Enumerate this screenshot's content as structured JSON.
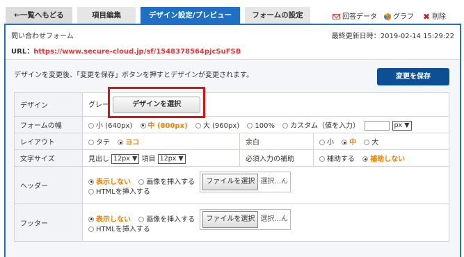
{
  "tabs": {
    "back": "←一覧へもどる",
    "items": "項目編集",
    "design": "デザイン設定/プレビュー",
    "form_settings": "フォームの設定"
  },
  "top_links": {
    "answers": "回答データ",
    "graph": "グラフ",
    "delete": "削除"
  },
  "info": {
    "form_name": "問い合わせフォーム",
    "last_update": "最終更新日時：2019-02-14 15:29:22",
    "url_label": "URL：",
    "url_value": "https://www.secure-cloud.jp/sf/1548378564pjcSuFSB"
  },
  "notice": "デザインを変更後、「変更を保存」ボタンを押すとデザインが変更されます。",
  "save_button": "変更を保存",
  "rows": {
    "design": {
      "label": "デザイン",
      "current": "グレー",
      "choose_button": "デザインを選択"
    },
    "width": {
      "label": "フォームの幅",
      "options": [
        "小 (640px)",
        "中 (800px)",
        "大 (960px)",
        "100%",
        "カスタム（値を入力）"
      ],
      "selected": "中 (800px)",
      "unit": "px ▼"
    },
    "layout": {
      "label": "レイアウト",
      "options": [
        "タテ",
        "ヨコ"
      ],
      "selected": "ヨコ"
    },
    "margin": {
      "label": "余白",
      "options": [
        "小",
        "中",
        "大"
      ],
      "selected": "中"
    },
    "font_size": {
      "label": "文字サイズ",
      "heading_label": "見出し",
      "heading_value": "12px ▼",
      "item_label": "項目",
      "item_value": "12px ▼"
    },
    "required_help": {
      "label": "必須入力の補助",
      "options": [
        "補助する",
        "補助しない"
      ],
      "selected": "補助しない"
    },
    "header": {
      "label": "ヘッダー",
      "options": [
        "表示しない",
        "画像を挿入する",
        "HTMLを挿入する"
      ],
      "selected": "表示しない",
      "file_button": "ファイルを選択",
      "file_status": "選択...ん"
    },
    "footer": {
      "label": "フッター",
      "options": [
        "表示しない",
        "画像を挿入する",
        "HTMLを挿入する"
      ],
      "selected": "表示しない",
      "file_button": "ファイルを選択",
      "file_status": "選択...ん"
    }
  },
  "colors": {
    "accent_blue": "#1f6fc5",
    "save_button": "#0d4f94",
    "selected_orange": "#f08300",
    "url_red": "#d83a3a",
    "highlight_red": "#e01010"
  }
}
